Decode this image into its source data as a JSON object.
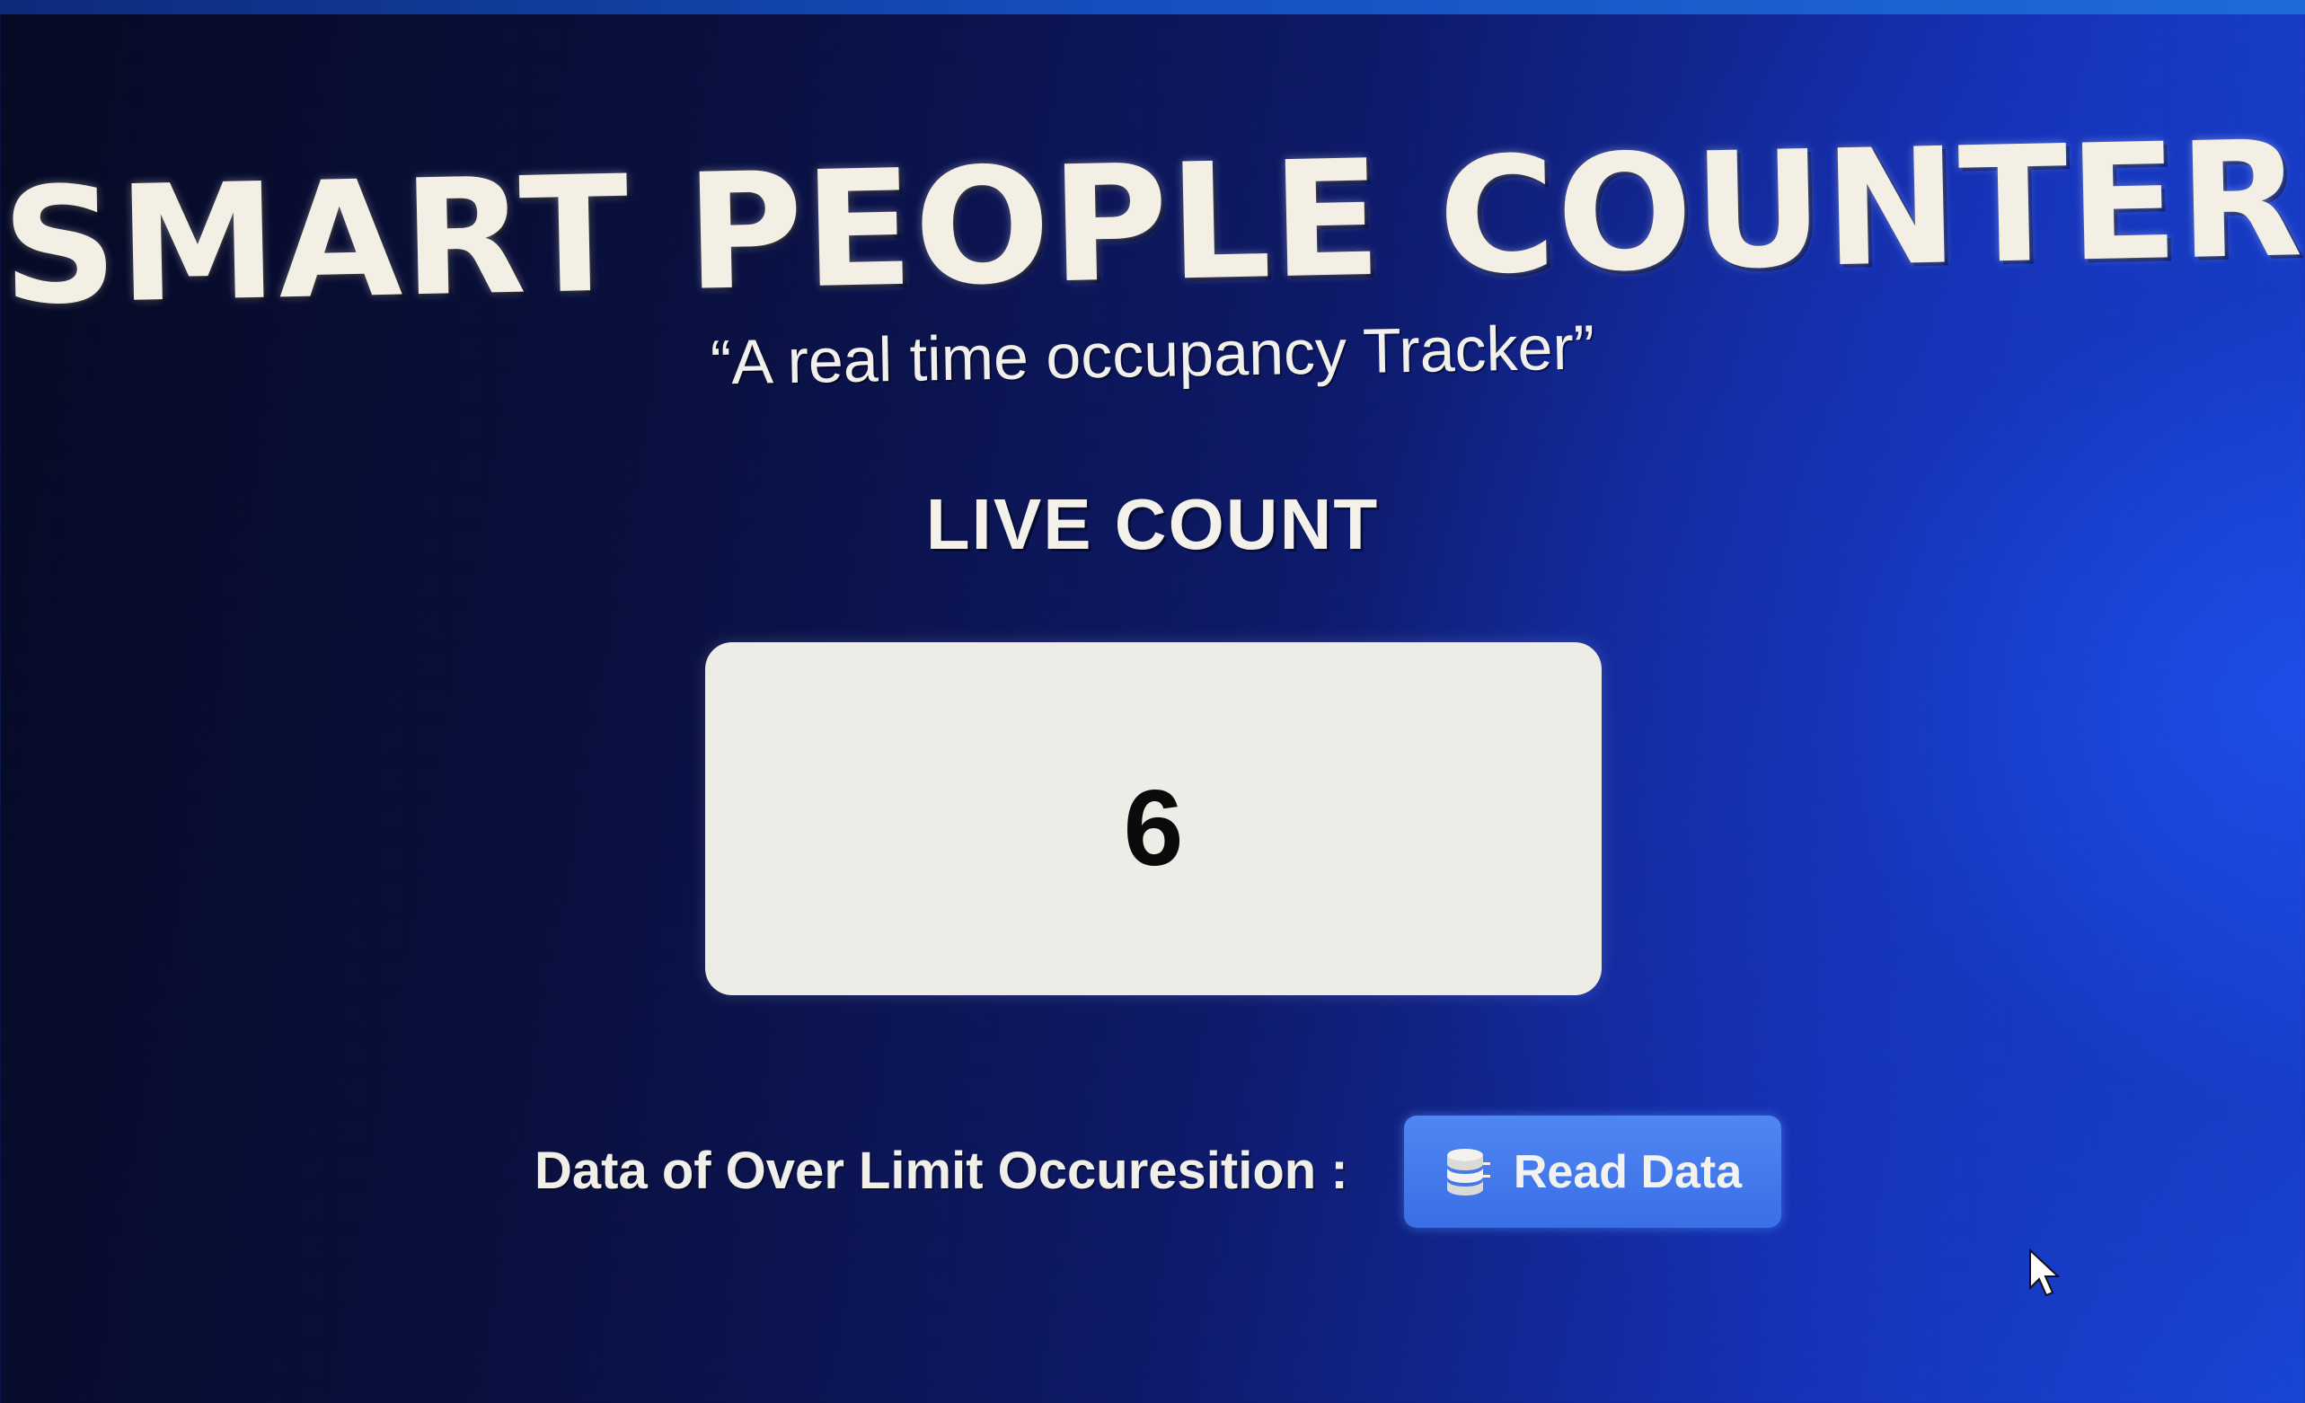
{
  "header": {
    "title": "SMART PEOPLE COUNTER",
    "subtitle": "“A real time occupancy Tracker”"
  },
  "live": {
    "label": "LIVE COUNT",
    "count": "6"
  },
  "over_limit": {
    "label": "Data of Over Limit Occuresition :",
    "button_label": "Read Data",
    "button_icon": "database-icon"
  },
  "colors": {
    "background_dark": "#060a24",
    "background_blue": "#1a48d8",
    "button_blue": "#3a6fe6",
    "count_box": "#eeece6"
  }
}
